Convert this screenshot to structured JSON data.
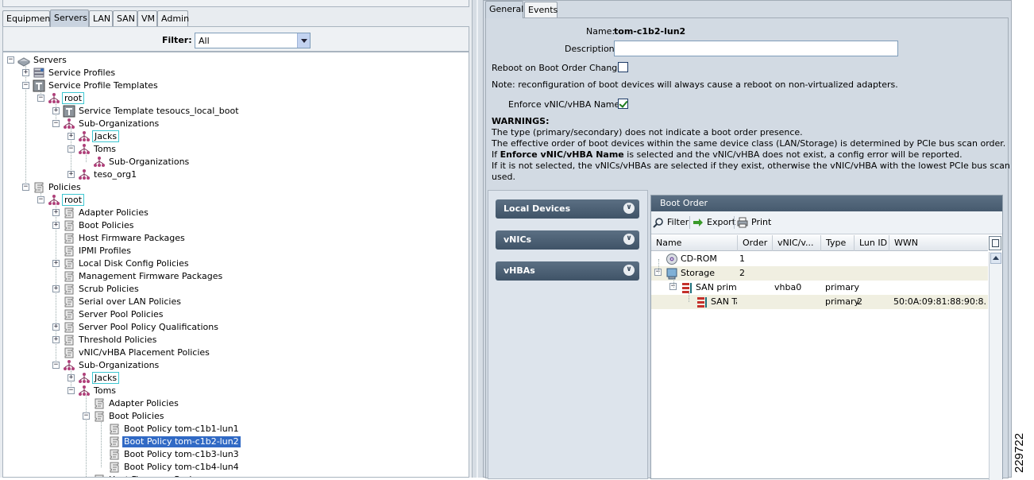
{
  "nav_tabs": [
    "Equipment",
    "Servers",
    "LAN",
    "SAN",
    "VM",
    "Admin"
  ],
  "active_nav_tab": "Servers",
  "filter": {
    "label": "Filter:",
    "value": "All"
  },
  "tree": [
    {
      "label": "Servers",
      "depth": 0,
      "expander": "-",
      "icon": "servers-icon"
    },
    {
      "label": "Service Profiles",
      "depth": 1,
      "expander": "+",
      "icon": "service-profiles-icon"
    },
    {
      "label": "Service Profile Templates",
      "depth": 1,
      "expander": "-",
      "icon": "template-icon"
    },
    {
      "label": "root",
      "depth": 2,
      "expander": "-",
      "icon": "org-icon",
      "boxed": true
    },
    {
      "label": "Service Template tesoucs_local_boot",
      "depth": 3,
      "expander": "+",
      "icon": "template-icon"
    },
    {
      "label": "Sub-Organizations",
      "depth": 3,
      "expander": "-",
      "icon": "org-icon"
    },
    {
      "label": "Jacks",
      "depth": 4,
      "expander": "+",
      "icon": "org-icon",
      "boxed": true
    },
    {
      "label": "Toms",
      "depth": 4,
      "expander": "-",
      "icon": "org-icon"
    },
    {
      "label": "Sub-Organizations",
      "depth": 5,
      "expander": "",
      "icon": "org-icon"
    },
    {
      "label": "teso_org1",
      "depth": 4,
      "expander": "+",
      "icon": "org-icon"
    },
    {
      "label": "Policies",
      "depth": 1,
      "expander": "-",
      "icon": "policy-icon"
    },
    {
      "label": "root",
      "depth": 2,
      "expander": "-",
      "icon": "org-icon",
      "boxed": true
    },
    {
      "label": "Adapter Policies",
      "depth": 3,
      "expander": "+",
      "icon": "policy-icon"
    },
    {
      "label": "Boot Policies",
      "depth": 3,
      "expander": "+",
      "icon": "policy-icon"
    },
    {
      "label": "Host Firmware Packages",
      "depth": 3,
      "expander": "",
      "icon": "policy-icon"
    },
    {
      "label": "IPMI Profiles",
      "depth": 3,
      "expander": "",
      "icon": "policy-icon"
    },
    {
      "label": "Local Disk Config Policies",
      "depth": 3,
      "expander": "+",
      "icon": "policy-icon"
    },
    {
      "label": "Management Firmware Packages",
      "depth": 3,
      "expander": "",
      "icon": "policy-icon"
    },
    {
      "label": "Scrub Policies",
      "depth": 3,
      "expander": "+",
      "icon": "policy-icon"
    },
    {
      "label": "Serial over LAN Policies",
      "depth": 3,
      "expander": "",
      "icon": "policy-icon"
    },
    {
      "label": "Server Pool Policies",
      "depth": 3,
      "expander": "",
      "icon": "policy-icon"
    },
    {
      "label": "Server Pool Policy Qualifications",
      "depth": 3,
      "expander": "+",
      "icon": "policy-icon"
    },
    {
      "label": "Threshold Policies",
      "depth": 3,
      "expander": "+",
      "icon": "policy-icon"
    },
    {
      "label": "vNIC/vHBA Placement Policies",
      "depth": 3,
      "expander": "",
      "icon": "policy-icon"
    },
    {
      "label": "Sub-Organizations",
      "depth": 3,
      "expander": "-",
      "icon": "org-icon"
    },
    {
      "label": "Jacks",
      "depth": 4,
      "expander": "+",
      "icon": "org-icon",
      "boxed": true
    },
    {
      "label": "Toms",
      "depth": 4,
      "expander": "-",
      "icon": "org-icon"
    },
    {
      "label": "Adapter Policies",
      "depth": 5,
      "expander": "",
      "icon": "policy-icon"
    },
    {
      "label": "Boot Policies",
      "depth": 5,
      "expander": "-",
      "icon": "policy-icon"
    },
    {
      "label": "Boot Policy tom-c1b1-lun1",
      "depth": 6,
      "expander": "",
      "icon": "policy-icon"
    },
    {
      "label": "Boot Policy tom-c1b2-lun2",
      "depth": 6,
      "expander": "",
      "icon": "policy-icon",
      "selected": true
    },
    {
      "label": "Boot Policy tom-c1b3-lun3",
      "depth": 6,
      "expander": "",
      "icon": "policy-icon"
    },
    {
      "label": "Boot Policy tom-c1b4-lun4",
      "depth": 6,
      "expander": "",
      "icon": "policy-icon"
    },
    {
      "label": "Host Firmware Packages",
      "depth": 5,
      "expander": "",
      "icon": "policy-icon"
    }
  ],
  "detail_tabs": [
    "General",
    "Events"
  ],
  "active_detail_tab": "General",
  "general": {
    "name_label": "Name:",
    "name_value": "tom-c1b2-lun2",
    "description_label": "Description:",
    "description_value": "",
    "reboot_label": "Reboot on Boot Order Change:",
    "reboot_checked": false,
    "note": "Note: reconfiguration of boot devices will always cause a reboot on non-virtualized adapters.",
    "enforce_label": "Enforce vNIC/vHBA Name:",
    "enforce_checked": true,
    "warnings_title": "WARNINGS:",
    "warning_1": "The type (primary/secondary) does not indicate a boot order presence.",
    "warning_2": "The effective order of boot devices within the same device class (LAN/Storage) is determined by PCIe bus scan order.",
    "warning_3_prefix": "If ",
    "warning_3_bold": "Enforce vNIC/vHBA Name",
    "warning_3_suffix": " is selected and the vNIC/vHBA does not exist, a config error will be reported.",
    "warning_4": "If it is not selected, the vNICs/vHBAs are selected if they exist, otherwise the vNIC/vHBA with the lowest PCIe bus scan order is",
    "warning_5": "used."
  },
  "accordion": [
    "Local Devices",
    "vNICs",
    "vHBAs"
  ],
  "boot_order": {
    "title": "Boot Order",
    "toolbar": [
      "Filter",
      "Export",
      "Print"
    ],
    "columns": [
      "Name",
      "Order",
      "vNIC/v...",
      "Type",
      "Lun ID",
      "WWN"
    ],
    "rows": [
      {
        "name": "CD-ROM",
        "order": "1",
        "vnic": "",
        "type": "",
        "lun": "",
        "wwn": "",
        "indent": 0,
        "expander": "",
        "icon": "cdrom-icon"
      },
      {
        "name": "Storage",
        "order": "2",
        "vnic": "",
        "type": "",
        "lun": "",
        "wwn": "",
        "indent": 0,
        "expander": "-",
        "icon": "storage-icon"
      },
      {
        "name": "SAN primar",
        "order": "",
        "vnic": "vhba0",
        "type": "primary",
        "lun": "",
        "wwn": "",
        "indent": 1,
        "expander": "-",
        "icon": "san-icon"
      },
      {
        "name": "SAN Ta",
        "order": "",
        "vnic": "",
        "type": "primary",
        "lun": "2",
        "wwn": "50:0A:09:81:88:90:8...",
        "indent": 2,
        "expander": "",
        "icon": "san-target-icon"
      }
    ]
  },
  "figure_id": "229722",
  "colors": {
    "selection": "#316ac5",
    "header_dark": "#465a6e",
    "panel_bg": "#d2dae3",
    "highlight_box": "#3ec6d1"
  }
}
